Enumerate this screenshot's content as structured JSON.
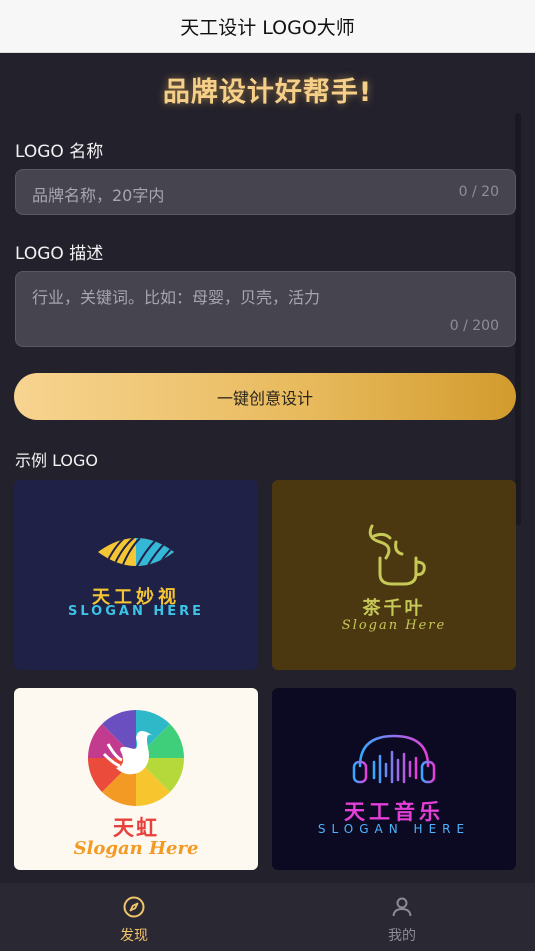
{
  "titlebar": {
    "title": "天工设计 LOGO大师"
  },
  "headline": "品牌设计好帮手!",
  "form": {
    "name_label": "LOGO 名称",
    "name_placeholder": "品牌名称，20字内",
    "name_counter": "0 / 20",
    "desc_label": "LOGO 描述",
    "desc_placeholder": "行业，关键词。比如：母婴，贝壳，活力",
    "desc_counter": "0 / 200",
    "submit_label": "一键创意设计"
  },
  "examples": {
    "heading": "示例 LOGO",
    "cards": [
      {
        "name": "天工妙视",
        "slogan": "SLOGAN HERE"
      },
      {
        "name": "茶千叶",
        "slogan": "Slogan Here"
      },
      {
        "name": "天虹",
        "slogan": "Slogan Here"
      },
      {
        "name": "天工音乐",
        "slogan": "SLOGAN HERE"
      }
    ]
  },
  "tabs": [
    {
      "label": "发现",
      "icon": "compass-icon",
      "active": true
    },
    {
      "label": "我的",
      "icon": "user-icon",
      "active": false
    }
  ],
  "colors": {
    "accent": "#f0c46c",
    "background": "#23212c",
    "active_tab": "#f0c46c",
    "inactive_tab": "#8c8a94"
  }
}
